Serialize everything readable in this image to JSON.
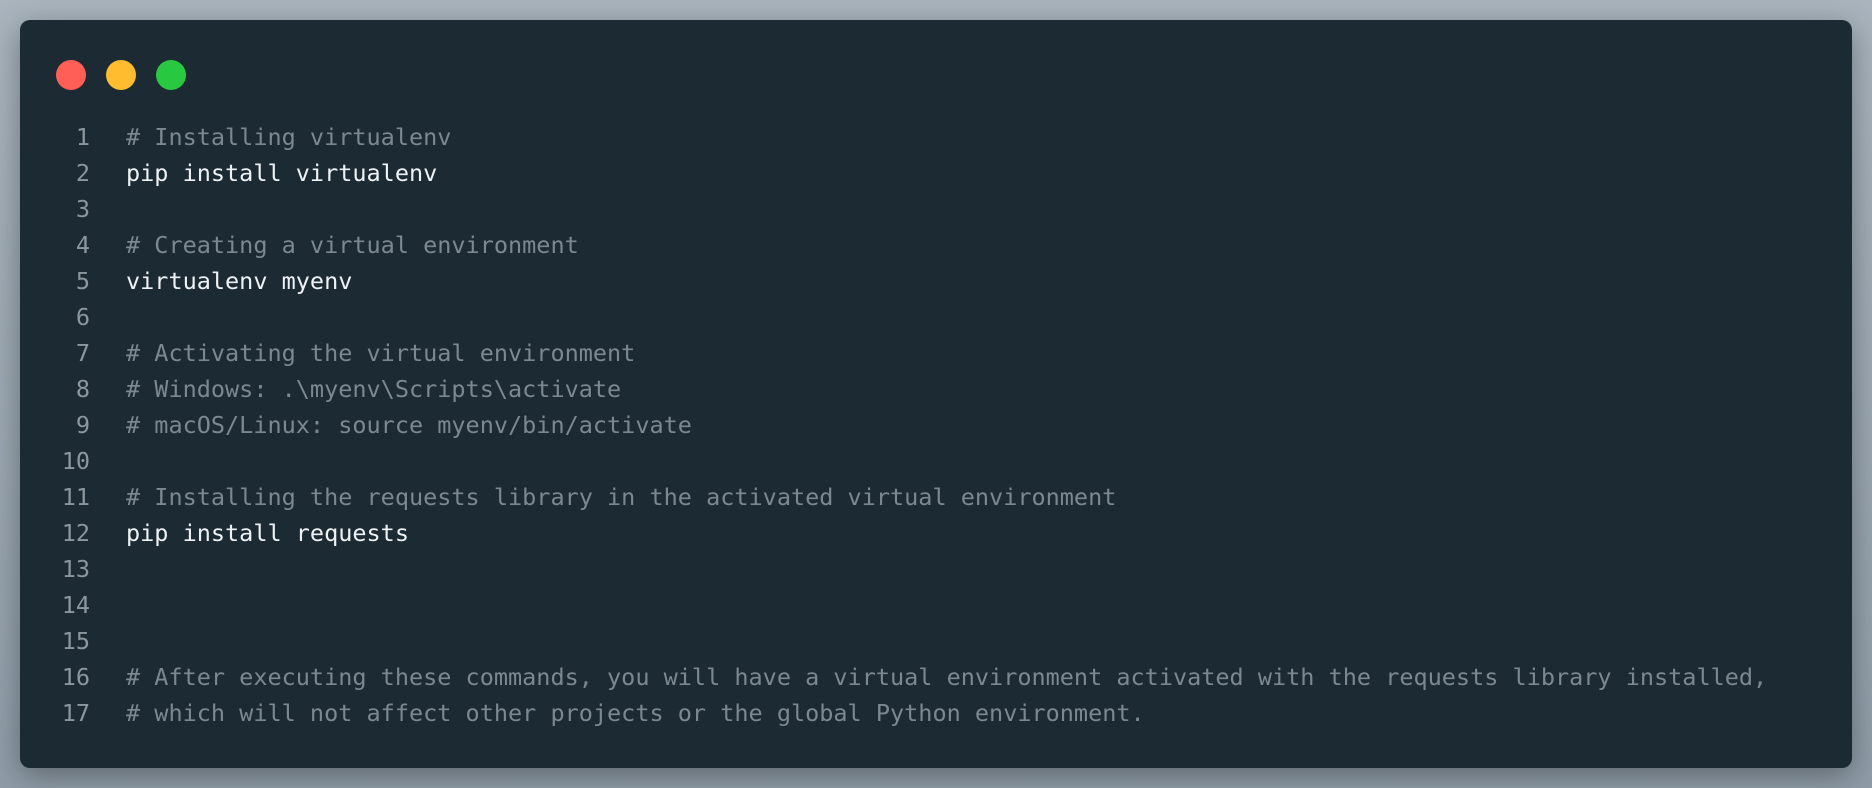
{
  "window_controls": [
    {
      "name": "close",
      "color": "#ff5f57"
    },
    {
      "name": "minimize",
      "color": "#febc2e"
    },
    {
      "name": "maximize",
      "color": "#28c840"
    }
  ],
  "code": {
    "comment_color": "#7b8891",
    "command_color": "#eef2f4",
    "lines": [
      {
        "num": "1",
        "text": "# Installing virtualenv",
        "kind": "comment"
      },
      {
        "num": "2",
        "text": "pip install virtualenv",
        "kind": "cmd"
      },
      {
        "num": "3",
        "text": "",
        "kind": "cmd"
      },
      {
        "num": "4",
        "text": "# Creating a virtual environment",
        "kind": "comment"
      },
      {
        "num": "5",
        "text": "virtualenv myenv",
        "kind": "cmd"
      },
      {
        "num": "6",
        "text": "",
        "kind": "cmd"
      },
      {
        "num": "7",
        "text": "# Activating the virtual environment",
        "kind": "comment"
      },
      {
        "num": "8",
        "text": "# Windows: .\\myenv\\Scripts\\activate",
        "kind": "comment"
      },
      {
        "num": "9",
        "text": "# macOS/Linux: source myenv/bin/activate",
        "kind": "comment"
      },
      {
        "num": "10",
        "text": "",
        "kind": "cmd"
      },
      {
        "num": "11",
        "text": "# Installing the requests library in the activated virtual environment",
        "kind": "comment"
      },
      {
        "num": "12",
        "text": "pip install requests",
        "kind": "cmd"
      },
      {
        "num": "13",
        "text": "",
        "kind": "cmd"
      },
      {
        "num": "14",
        "text": "",
        "kind": "cmd"
      },
      {
        "num": "15",
        "text": "",
        "kind": "cmd"
      },
      {
        "num": "16",
        "text": "# After executing these commands, you will have a virtual environment activated with the requests library installed,",
        "kind": "comment"
      },
      {
        "num": "17",
        "text": "# which will not affect other projects or the global Python environment.",
        "kind": "comment"
      }
    ]
  }
}
